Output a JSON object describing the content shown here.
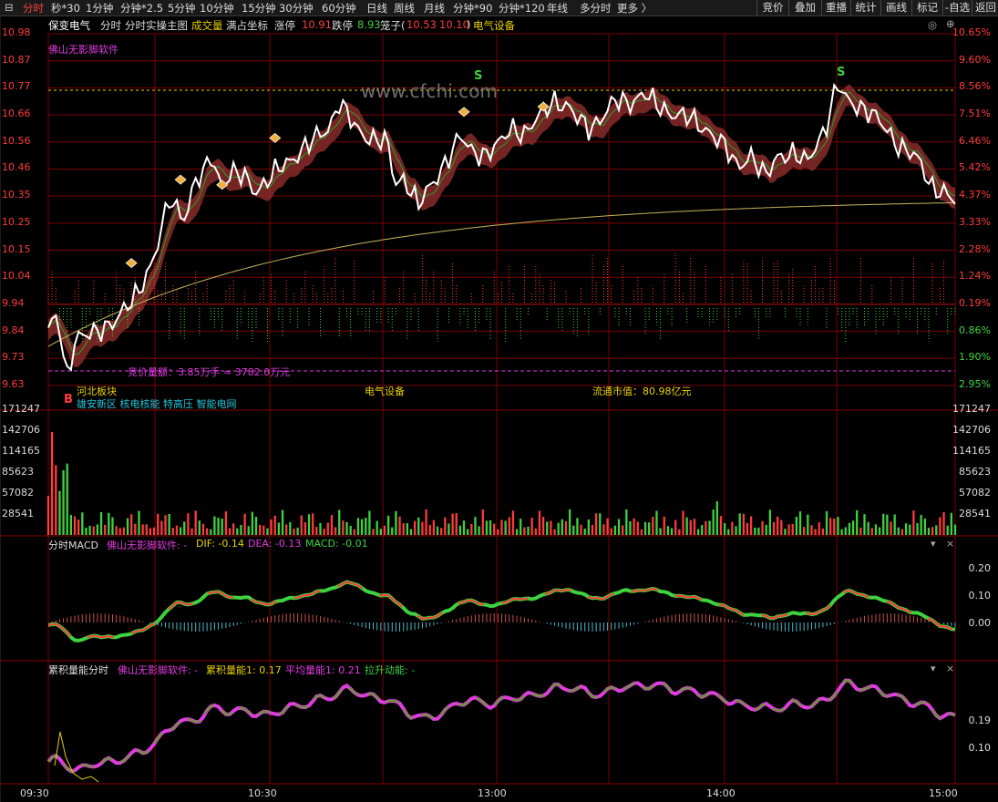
{
  "toolbar": {
    "tabs": [
      "分时",
      "秒*30",
      "1分钟",
      "分钟*2.5",
      "5分钟",
      "10分钟",
      "15分钟",
      "30分钟",
      "60分钟",
      "日线",
      "周线",
      "月线",
      "分钟*90",
      "分钟*120",
      "年线",
      "多分时",
      "更多 〉"
    ],
    "right_buttons": [
      "竞价",
      "叠加",
      "重播",
      "统计",
      "画线",
      "标记",
      "-自选",
      "返回"
    ]
  },
  "info": {
    "stock_name": "保变电气",
    "mode1": "分时",
    "mode2": "分时实操主图",
    "volume_label": "成交量",
    "coords_label": "满占坐标",
    "limit_up_label": "涨停",
    "limit_up_value": "10.91",
    "limit_down_label": "跌停",
    "limit_down_value": "8.93",
    "cage_label": "笼子(",
    "cage_high": "10.53",
    "cage_low": "10.10",
    "cage_close": ")",
    "sector": "电气设备",
    "indicator_name": "佛山无影脚软件",
    "watermark": "www.cfchi.com"
  },
  "price_axis": {
    "left": [
      "10.98",
      "10.87",
      "10.77",
      "10.66",
      "10.56",
      "10.46",
      "10.35",
      "10.25",
      "10.15",
      "10.04",
      "9.94",
      "9.84",
      "9.73",
      "9.63"
    ],
    "right": [
      "10.65%",
      "9.60%",
      "8.56%",
      "7.51%",
      "6.46%",
      "5.42%",
      "4.37%",
      "3.33%",
      "2.28%",
      "1.24%",
      "0.19%",
      "0.86%",
      "1.90%",
      "2.95%"
    ]
  },
  "annotations": {
    "auction": "竞价量额：3.85万手 ≈ 3782.0万元",
    "sector_board": "河北板块",
    "concepts": "雄安新区 核电核能 特高压 智能电网",
    "industry": "电气设备",
    "market_cap": "流通市值：80.98亿元",
    "buy_mark": "B",
    "sell_mark": "S"
  },
  "volume_axis": [
    "171247",
    "142706",
    "114165",
    "85623",
    "57082",
    "28541"
  ],
  "macd": {
    "title": "分时MACD",
    "source": "佛山无影脚软件: -",
    "dif": "DIF: -0.14",
    "dea": "DEA: -0.13",
    "macd": "MACD: -0.01",
    "axis": [
      "0.20",
      "0.10",
      "0.00"
    ]
  },
  "energy": {
    "title": "累积量能分时",
    "source": "佛山无影脚软件: -",
    "cum": "累积量能1: 0.17",
    "avg": "平均量能1: 0.21",
    "lift": "拉升动能: -",
    "axis": [
      "0.19",
      "0.10"
    ]
  },
  "time_axis": [
    "09:30",
    "10:30",
    "13:00",
    "14:00",
    "15:00"
  ],
  "panel_controls": {
    "down": "▾",
    "close": "×"
  },
  "colors": {
    "up": "#ff3b3b",
    "down": "#3fd23f",
    "avg_line": "#c8b45a",
    "price_line": "#ffffff",
    "grid": "#7a0000",
    "magenta": "#e03ce0",
    "yellow": "#e8d000"
  }
}
